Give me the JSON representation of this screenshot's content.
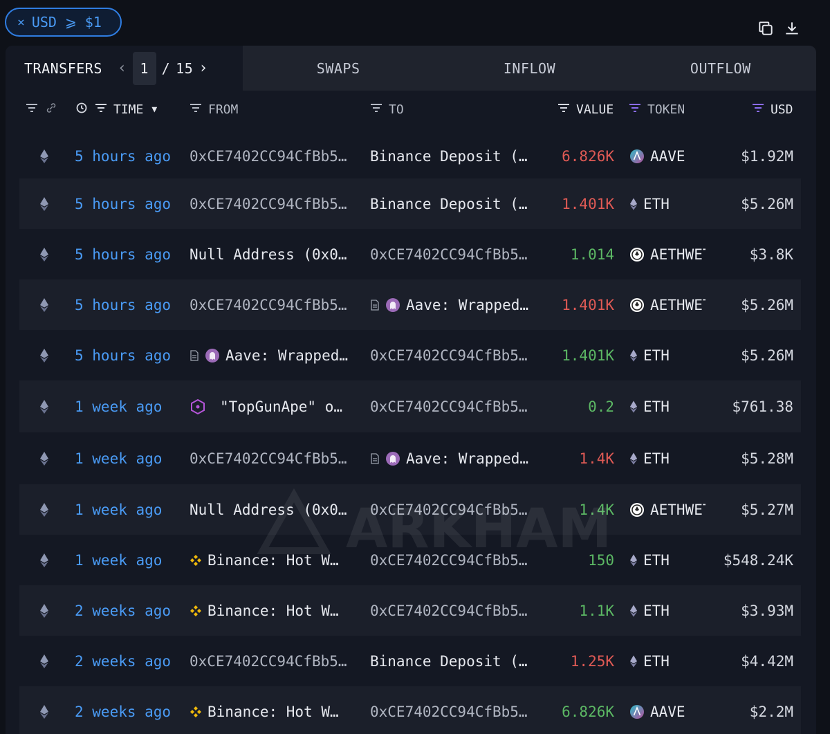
{
  "filter_chip": {
    "close": "×",
    "label": "USD ⩾ $1"
  },
  "tabs": {
    "transfers": "TRANSFERS",
    "page_current": "1",
    "page_sep": "/",
    "page_total": "15",
    "swaps": "SWAPS",
    "inflow": "INFLOW",
    "outflow": "OUTFLOW"
  },
  "columns": {
    "time": "TIME",
    "from": "FROM",
    "to": "TO",
    "value": "VALUE",
    "token": "TOKEN",
    "usd": "USD"
  },
  "watermark": "ARKHAM",
  "colors": {
    "accent": "#4a9bf5",
    "negative": "#e05a55",
    "positive": "#5cb864",
    "filter_active": "#8b6cf0"
  },
  "rows": [
    {
      "time": "5 hours ago",
      "from": "0xCE7402CC94CfBb5…",
      "from_style": "dim",
      "to": "Binance Deposit (…",
      "to_style": "bright",
      "value": "6.826K",
      "sign": "neg",
      "token": "AAVE",
      "token_icon": "aave-icon",
      "usd": "$1.92M"
    },
    {
      "time": "5 hours ago",
      "from": "0xCE7402CC94CfBb5…",
      "from_style": "dim",
      "to": "Binance Deposit (…",
      "to_style": "bright",
      "value": "1.401K",
      "sign": "neg",
      "token": "ETH",
      "token_icon": "eth-icon",
      "usd": "$5.26M"
    },
    {
      "time": "5 hours ago",
      "from": "Null Address (0x0…",
      "from_style": "bright",
      "to": "0xCE7402CC94CfBb5…",
      "to_style": "dim",
      "value": "1.014",
      "sign": "pos",
      "token": "AETHWETH",
      "token_icon": "aethweth-icon",
      "usd": "$3.8K"
    },
    {
      "time": "5 hours ago",
      "from": "0xCE7402CC94CfBb5…",
      "from_style": "dim",
      "to": "Aave: Wrapped…",
      "to_style": "bright",
      "to_icon": "aave-contract",
      "value": "1.401K",
      "sign": "neg",
      "token": "AETHWETH",
      "token_icon": "aethweth-icon",
      "usd": "$5.26M"
    },
    {
      "time": "5 hours ago",
      "from": "Aave: Wrapped…",
      "from_style": "bright",
      "from_icon": "aave-contract",
      "to": "0xCE7402CC94CfBb5…",
      "to_style": "dim",
      "value": "1.401K",
      "sign": "pos",
      "token": "ETH",
      "token_icon": "eth-icon",
      "usd": "$5.26M"
    },
    {
      "time": "1 week ago",
      "from": "\"TopGunApe\" o…",
      "from_style": "bright",
      "from_icon": "nft",
      "to": "0xCE7402CC94CfBb5…",
      "to_style": "dim",
      "value": "0.2",
      "sign": "pos",
      "token": "ETH",
      "token_icon": "eth-icon",
      "usd": "$761.38"
    },
    {
      "time": "1 week ago",
      "from": "0xCE7402CC94CfBb5…",
      "from_style": "dim",
      "to": "Aave: Wrapped…",
      "to_style": "bright",
      "to_icon": "aave-contract",
      "value": "1.4K",
      "sign": "neg",
      "token": "ETH",
      "token_icon": "eth-icon",
      "usd": "$5.28M"
    },
    {
      "time": "1 week ago",
      "from": "Null Address (0x0…",
      "from_style": "bright",
      "to": "0xCE7402CC94CfBb5…",
      "to_style": "dim",
      "value": "1.4K",
      "sign": "pos",
      "token": "AETHWETH",
      "token_icon": "aethweth-icon",
      "usd": "$5.27M"
    },
    {
      "time": "1 week ago",
      "from": "Binance: Hot W…",
      "from_style": "bright",
      "from_icon": "binance",
      "to": "0xCE7402CC94CfBb5…",
      "to_style": "dim",
      "value": "150",
      "sign": "pos",
      "token": "ETH",
      "token_icon": "eth-icon",
      "usd": "$548.24K"
    },
    {
      "time": "2 weeks ago",
      "from": "Binance: Hot W…",
      "from_style": "bright",
      "from_icon": "binance",
      "to": "0xCE7402CC94CfBb5…",
      "to_style": "dim",
      "value": "1.1K",
      "sign": "pos",
      "token": "ETH",
      "token_icon": "eth-icon",
      "usd": "$3.93M"
    },
    {
      "time": "2 weeks ago",
      "from": "0xCE7402CC94CfBb5…",
      "from_style": "dim",
      "to": "Binance Deposit (…",
      "to_style": "bright",
      "value": "1.25K",
      "sign": "neg",
      "token": "ETH",
      "token_icon": "eth-icon",
      "usd": "$4.42M"
    },
    {
      "time": "2 weeks ago",
      "from": "Binance: Hot W…",
      "from_style": "bright",
      "from_icon": "binance",
      "to": "0xCE7402CC94CfBb5…",
      "to_style": "dim",
      "value": "6.826K",
      "sign": "pos",
      "token": "AAVE",
      "token_icon": "aave-icon",
      "usd": "$2.2M"
    }
  ]
}
